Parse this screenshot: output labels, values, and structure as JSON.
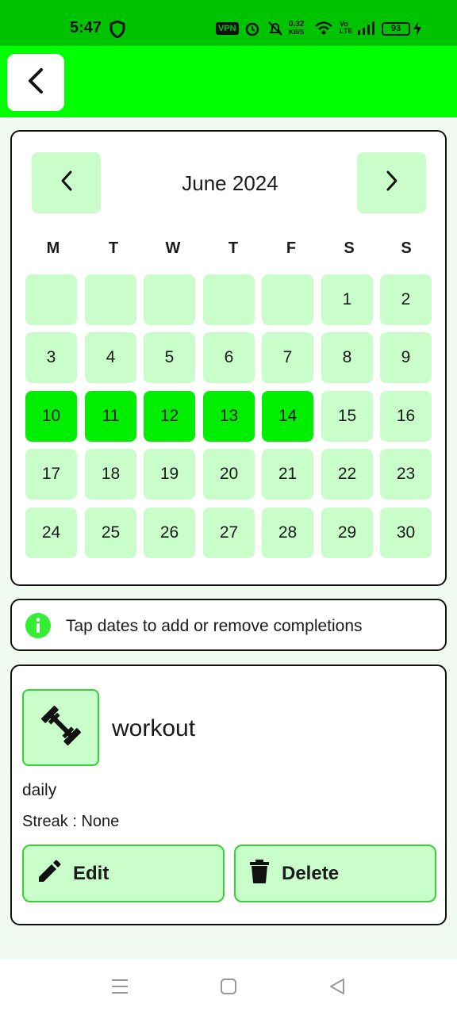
{
  "status_bar": {
    "time": "5:47",
    "vpn": "VPN",
    "net_speed": "0.32",
    "net_unit": "KB/S",
    "battery": "93"
  },
  "app_bar": {
    "back_icon": "chevron-left-icon"
  },
  "calendar": {
    "month_title": "June 2024",
    "prev_icon": "chevron-left-icon",
    "next_icon": "chevron-right-icon",
    "weekdays": [
      "M",
      "T",
      "W",
      "T",
      "F",
      "S",
      "S"
    ],
    "days": [
      "",
      "",
      "",
      "",
      "",
      "1",
      "2",
      "3",
      "4",
      "5",
      "6",
      "7",
      "8",
      "9",
      "10",
      "11",
      "12",
      "13",
      "14",
      "15",
      "16",
      "17",
      "18",
      "19",
      "20",
      "21",
      "22",
      "23",
      "24",
      "25",
      "26",
      "27",
      "28",
      "29",
      "30"
    ],
    "completed_days": [
      "10",
      "11",
      "12",
      "13",
      "14"
    ]
  },
  "info": {
    "icon": "info-icon",
    "text": "Tap dates to add or remove completions"
  },
  "habit": {
    "icon": "dumbbell-icon",
    "name": "workout",
    "frequency": "daily",
    "streak": "Streak : None",
    "edit_label": "Edit",
    "delete_label": "Delete"
  },
  "colors": {
    "status_bar": "#00c300",
    "app_bar": "#00ff00",
    "cell": "#c9fdc9",
    "cell_completed": "#00ee00",
    "button_border": "#36d136"
  }
}
